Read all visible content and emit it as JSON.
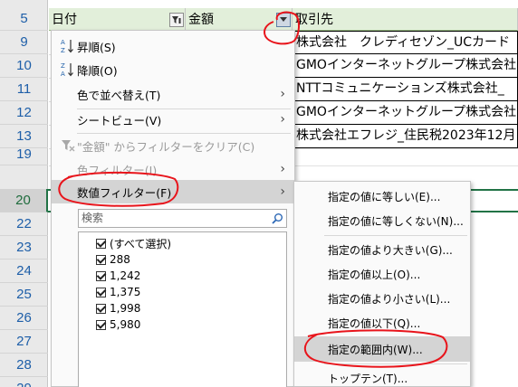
{
  "row_numbers": [
    "5",
    "9",
    "10",
    "11",
    "12",
    "13",
    "19",
    "20",
    "22",
    "23",
    "24",
    "25",
    "26",
    "27",
    "28",
    "29"
  ],
  "active_row": "20",
  "header": {
    "col_date": "日付",
    "col_amount": "金額",
    "col_partner": "取引先"
  },
  "partner_cells": [
    "株式会社　クレディセゾン_UCカード",
    "GMOインターネットグループ株式会社",
    "NTTコミュニケーションズ株式会社_",
    "GMOインターネットグループ株式会社",
    "株式会社エフレジ_住民税2023年12月"
  ],
  "menu": {
    "sort_asc": "昇順(S)",
    "sort_desc": "降順(O)",
    "sort_by_color": "色で並べ替え(T)",
    "sheet_view": "シートビュー(V)",
    "clear_filter": "\"金額\" からフィルターをクリア(C)",
    "color_filter": "色フィルター(I)",
    "number_filter": "数値フィルター(F)",
    "search_placeholder": "検索",
    "values": [
      "(すべて選択)",
      "288",
      "1,242",
      "1,375",
      "1,998",
      "5,980"
    ]
  },
  "submenu": {
    "items": [
      "指定の値に等しい(E)...",
      "指定の値に等しくない(N)...",
      "指定の値より大きい(G)...",
      "指定の値以上(O)...",
      "指定の値より小さい(L)...",
      "指定の値以下(Q)...",
      "指定の範囲内(W)...",
      "トップテン(T)..."
    ]
  },
  "colors": {
    "header_fill": "#e2efda",
    "row_header_text": "#1d5ea8",
    "selection_green": "#217346",
    "annotation_red": "#e8141b",
    "menu_hover": "#d4d4d4"
  }
}
